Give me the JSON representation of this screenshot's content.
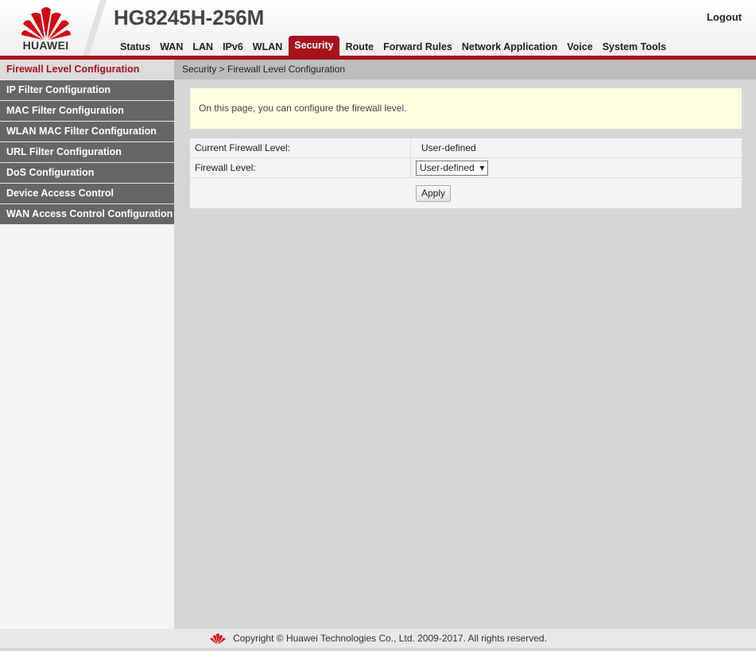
{
  "header": {
    "brand": "HUAWEI",
    "model": "HG8245H-256M",
    "logout": "Logout"
  },
  "nav": [
    {
      "label": "Status"
    },
    {
      "label": "WAN"
    },
    {
      "label": "LAN"
    },
    {
      "label": "IPv6"
    },
    {
      "label": "WLAN"
    },
    {
      "label": "Security",
      "active": true
    },
    {
      "label": "Route"
    },
    {
      "label": "Forward Rules"
    },
    {
      "label": "Network Application"
    },
    {
      "label": "Voice"
    },
    {
      "label": "System Tools"
    }
  ],
  "sidebar": {
    "items": [
      {
        "label": "Firewall Level Configuration",
        "active": true
      },
      {
        "label": "IP Filter Configuration"
      },
      {
        "label": "MAC Filter Configuration"
      },
      {
        "label": "WLAN MAC Filter Configuration"
      },
      {
        "label": "URL Filter Configuration"
      },
      {
        "label": "DoS Configuration"
      },
      {
        "label": "Device Access Control"
      },
      {
        "label": "WAN Access Control Configuration"
      }
    ]
  },
  "breadcrumb": "Security > Firewall Level Configuration",
  "notice": "On this page, you can configure the firewall level.",
  "form": {
    "current_label": "Current Firewall Level:",
    "current_value": "User-defined",
    "level_label": "Firewall Level:",
    "level_selected": "User-defined",
    "apply_label": "Apply"
  },
  "footer": {
    "copyright": "Copyright © Huawei Technologies Co., Ltd. 2009-2017. All rights reserved."
  },
  "colors": {
    "brand_red": "#a8131b",
    "sidebar_gray": "#666666",
    "notice_bg": "#ffffe1"
  }
}
